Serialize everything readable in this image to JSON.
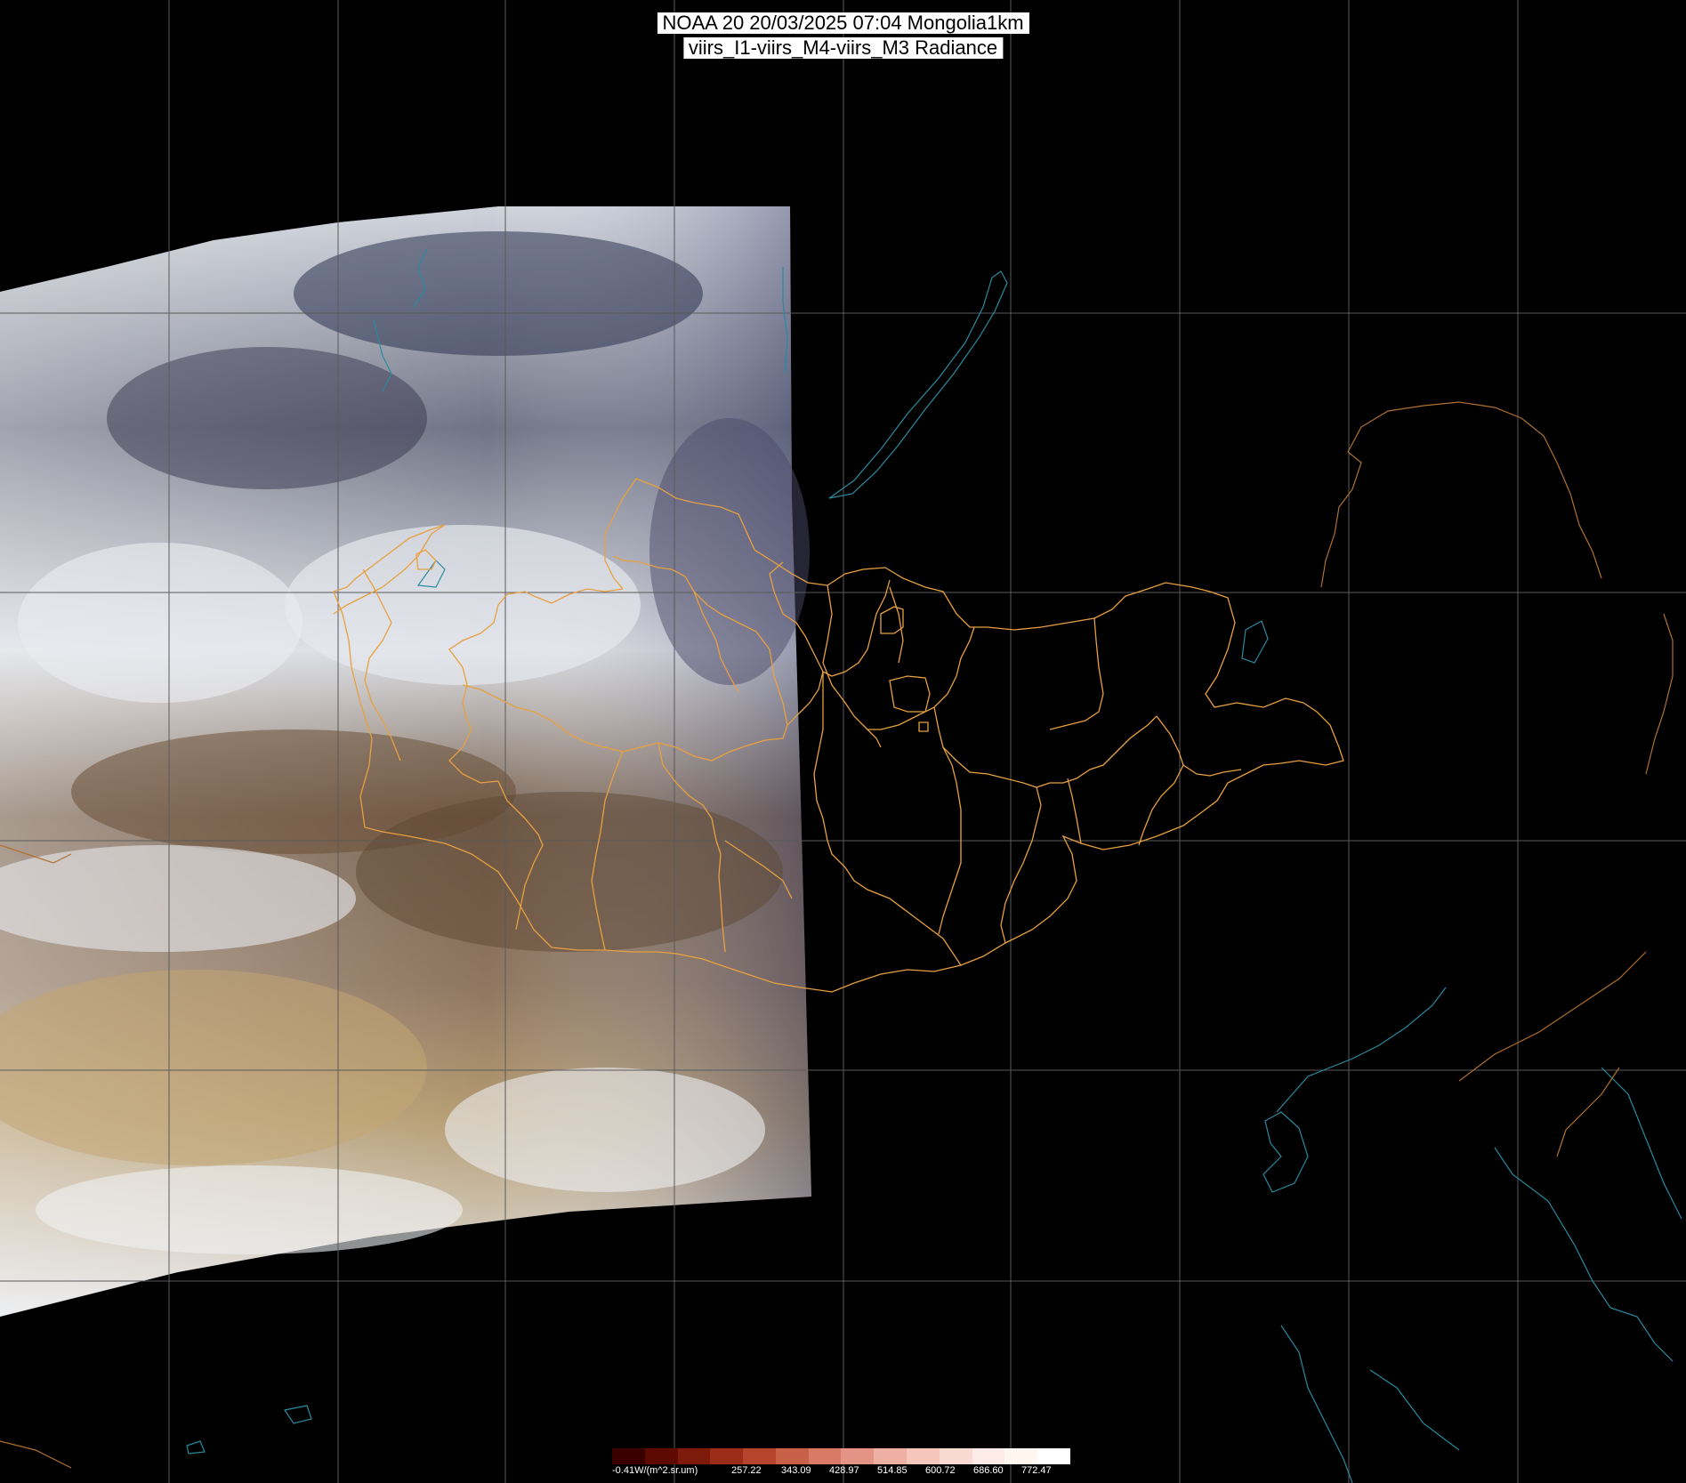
{
  "title": {
    "line1": "NOAA 20 20/03/2025 07:04 Mongolia1km",
    "line2": "viirs_I1-viirs_M4-viirs_M3 Radiance"
  },
  "colors": {
    "background": "#000000",
    "graticule": "#5a5a5a",
    "province_border": "#e8a040",
    "coastline": "#2a8aa0",
    "country_border": "#b07030",
    "title_bg": "#ffffff"
  },
  "colorbar": {
    "unit_label": "-0.41W/(m^2.sr.um)",
    "ticks": [
      "257.22",
      "343.09",
      "428.97",
      "514.85",
      "600.72",
      "686.60",
      "772.47"
    ],
    "colors": [
      "#3a0000",
      "#5e0a02",
      "#7d1a0a",
      "#9a2c18",
      "#b4452c",
      "#c86048",
      "#d87a66",
      "#e49484",
      "#eeb0a2",
      "#f4c6bc",
      "#f8dad2",
      "#fcebe6",
      "#fff6f0",
      "#ffffff"
    ]
  }
}
